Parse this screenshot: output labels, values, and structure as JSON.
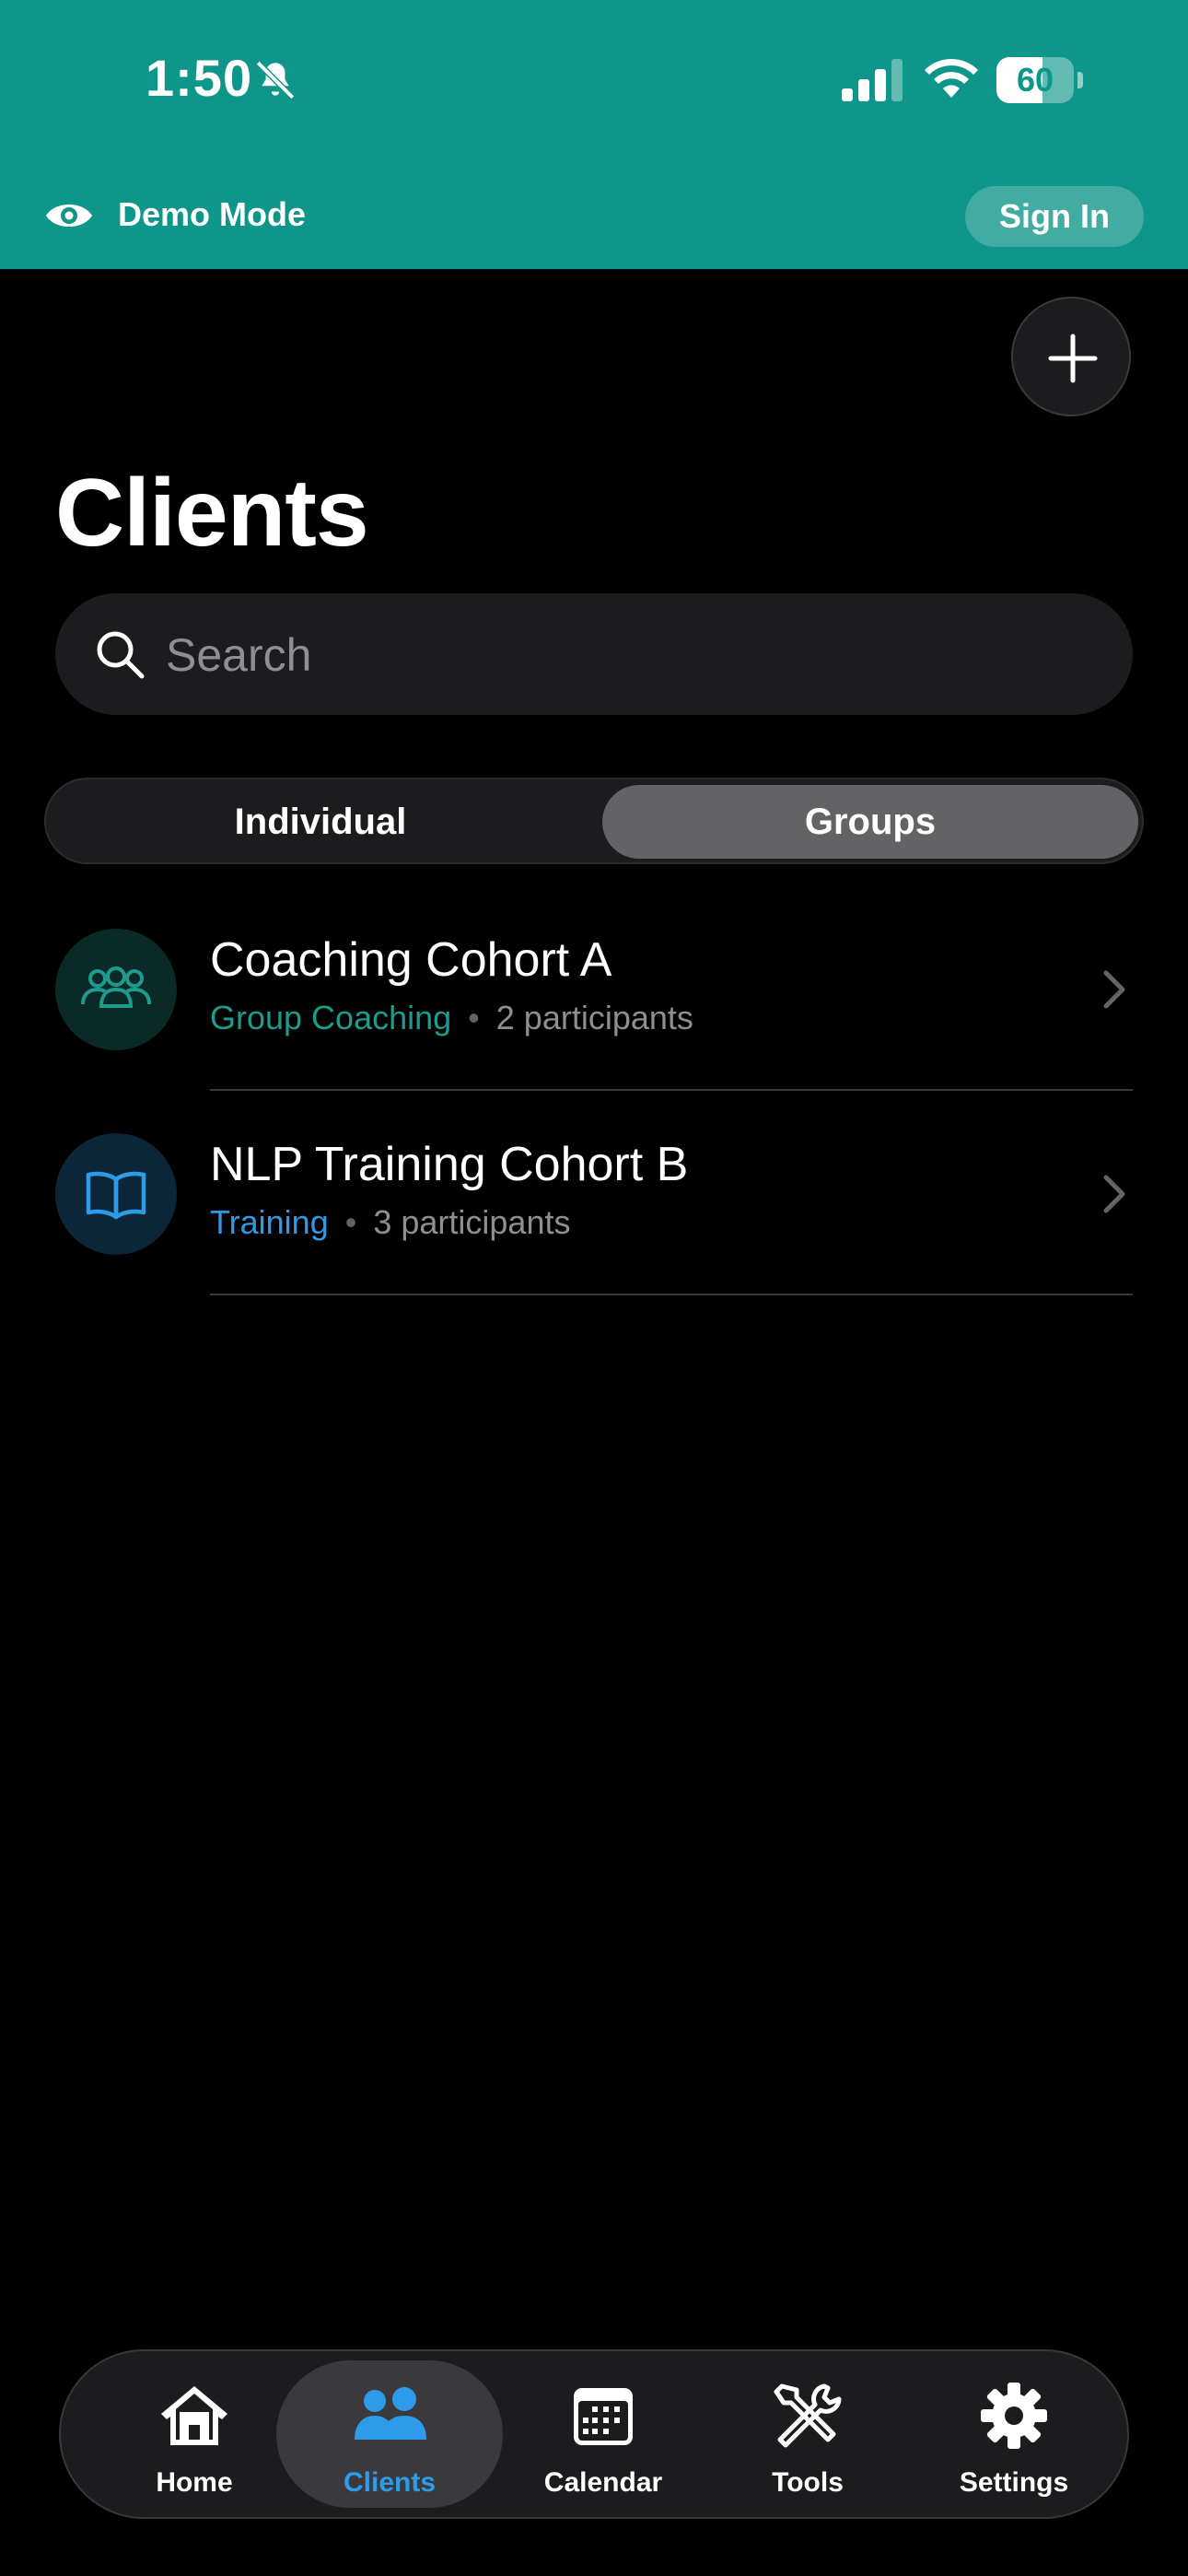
{
  "status_bar": {
    "time": "1:50",
    "battery_level": "60",
    "battery_fraction": 0.6
  },
  "demo_banner": {
    "label": "Demo Mode",
    "sign_in_label": "Sign In"
  },
  "page": {
    "title": "Clients"
  },
  "search": {
    "placeholder": "Search",
    "value": ""
  },
  "segments": {
    "options": [
      "Individual",
      "Groups"
    ],
    "selected": "Groups"
  },
  "groups": [
    {
      "name": "Coaching Cohort A",
      "category": "Group Coaching",
      "participants": "2 participants",
      "icon": "people-group-icon",
      "color": "#1f9a8e"
    },
    {
      "name": "NLP Training Cohort B",
      "category": "Training",
      "participants": "3 participants",
      "icon": "book-open-icon",
      "color": "#2e9bea"
    }
  ],
  "tab_bar": {
    "items": [
      {
        "label": "Home",
        "icon": "home-icon"
      },
      {
        "label": "Clients",
        "icon": "people-icon"
      },
      {
        "label": "Calendar",
        "icon": "calendar-icon"
      },
      {
        "label": "Tools",
        "icon": "tools-icon"
      },
      {
        "label": "Settings",
        "icon": "gear-icon"
      }
    ],
    "active": "Clients"
  },
  "colors": {
    "brand_teal": "#0f968a",
    "accent_blue": "#2e9bea"
  }
}
